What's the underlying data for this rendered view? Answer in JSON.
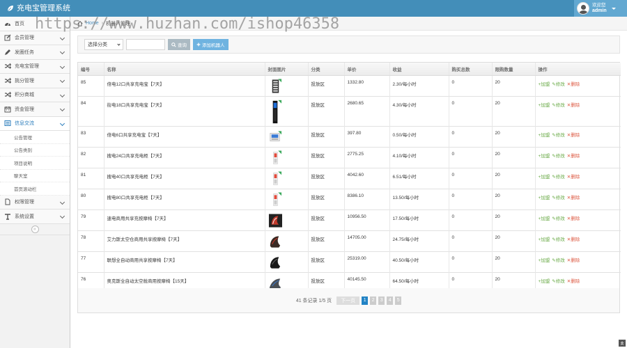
{
  "header": {
    "app_title": "充电宝管理系统",
    "user_greeting": "欢迎您",
    "user_name": "admin"
  },
  "sidebar": {
    "items": [
      {
        "label": "首页",
        "icon": "dashboard-icon",
        "has_chevron": false
      },
      {
        "label": "会员管理",
        "icon": "edit-icon",
        "has_chevron": true
      },
      {
        "label": "发圈任务",
        "icon": "pencil-icon",
        "has_chevron": true
      },
      {
        "label": "充电宝管理",
        "icon": "shuffle-icon",
        "has_chevron": true
      },
      {
        "label": "挑分管理",
        "icon": "shuffle-icon",
        "has_chevron": true
      },
      {
        "label": "积分商城",
        "icon": "shuffle-icon",
        "has_chevron": true
      },
      {
        "label": "资金管理",
        "icon": "calendar-icon",
        "has_chevron": true
      },
      {
        "label": "信息交流",
        "icon": "list-icon",
        "has_chevron": true,
        "active": true
      }
    ],
    "sub_items": [
      "公告管理",
      "公告类别",
      "项目说明",
      "聊天室",
      "首页滚动栏"
    ],
    "items_after": [
      {
        "label": "权限管理",
        "icon": "file-icon",
        "has_chevron": true
      },
      {
        "label": "系统设置",
        "icon": "tools-icon",
        "has_chevron": true
      }
    ],
    "collapse_glyph": "«"
  },
  "breadcrumb": {
    "home": "Home",
    "current": "机器人管理"
  },
  "watermark": "https://www.huzhan.com/ishop46358",
  "toolbar": {
    "select_value": "选择分类",
    "search_label": "查询",
    "add_label": "添加机器人"
  },
  "table": {
    "columns": [
      "编号",
      "名称",
      "封面图片",
      "分类",
      "单价",
      "收益",
      "购买总数",
      "限购数量",
      "操作"
    ],
    "op_labels": {
      "add": "加盟",
      "edit": "修改",
      "delete": "删除"
    },
    "rows": [
      {
        "id": "85",
        "name": "倍电12口共享充电宝【7天】",
        "category": "投放区",
        "price": "1332.80",
        "income": "2.30/每小时",
        "bought": "0",
        "limit": "20",
        "thumb": "cabinet12"
      },
      {
        "id": "84",
        "name": "街电18口共享充电宝【7天】",
        "category": "投放区",
        "price": "2680.65",
        "income": "4.30/每小时",
        "bought": "0",
        "limit": "20",
        "thumb": "tower"
      },
      {
        "id": "83",
        "name": "倍电6口共享充电宝【7天】",
        "category": "投放区",
        "price": "397.80",
        "income": "0.50/每小时",
        "bought": "0",
        "limit": "20",
        "thumb": "box6"
      },
      {
        "id": "82",
        "name": "搜电24口共享充电柜【7天】",
        "category": "投放区",
        "price": "2775.25",
        "income": "4.10/每小时",
        "bought": "0",
        "limit": "20",
        "thumb": "slim"
      },
      {
        "id": "81",
        "name": "搜电40口共享充电柜【7天】",
        "category": "投放区",
        "price": "4042.60",
        "income": "6.51/每小时",
        "bought": "0",
        "limit": "20",
        "thumb": "slim"
      },
      {
        "id": "80",
        "name": "搜电80口共享充电柜【7天】",
        "category": "投放区",
        "price": "8386.10",
        "income": "13.50/每小时",
        "bought": "0",
        "limit": "20",
        "thumb": "slim"
      },
      {
        "id": "79",
        "name": "速电商用共享充按摩椅【7天】",
        "category": "投放区",
        "price": "10956.50",
        "income": "17.50/每小时",
        "bought": "0",
        "limit": "20",
        "thumb": "chair-red"
      },
      {
        "id": "78",
        "name": "艾力斯太空仓商用共享按摩椅【7天】",
        "category": "投放区",
        "price": "14705.00",
        "income": "24.75/每小时",
        "bought": "0",
        "limit": "20",
        "thumb": "chair-dark"
      },
      {
        "id": "77",
        "name": "联想全自动商用共享按摩椅【7天】",
        "category": "投放区",
        "price": "25319.00",
        "income": "40.50/每小时",
        "bought": "0",
        "limit": "20",
        "thumb": "chair-black"
      },
      {
        "id": "76",
        "name": "奥克斯全自动太空舱商用按摩椅【15天】",
        "category": "投放区",
        "price": "40145.50",
        "income": "64.50/每小时",
        "bought": "0",
        "limit": "20",
        "thumb": "chair-gray"
      }
    ]
  },
  "pagination": {
    "info": "41 条记录 1/5 页",
    "prev_label": "下一页",
    "pages": [
      "1",
      "2",
      "3",
      "4",
      "5"
    ],
    "current": "1"
  },
  "colors": {
    "header_bg": "#438eb9",
    "accent": "#2283c5",
    "op_green": "#69aa46",
    "op_red": "#dd5a43"
  }
}
